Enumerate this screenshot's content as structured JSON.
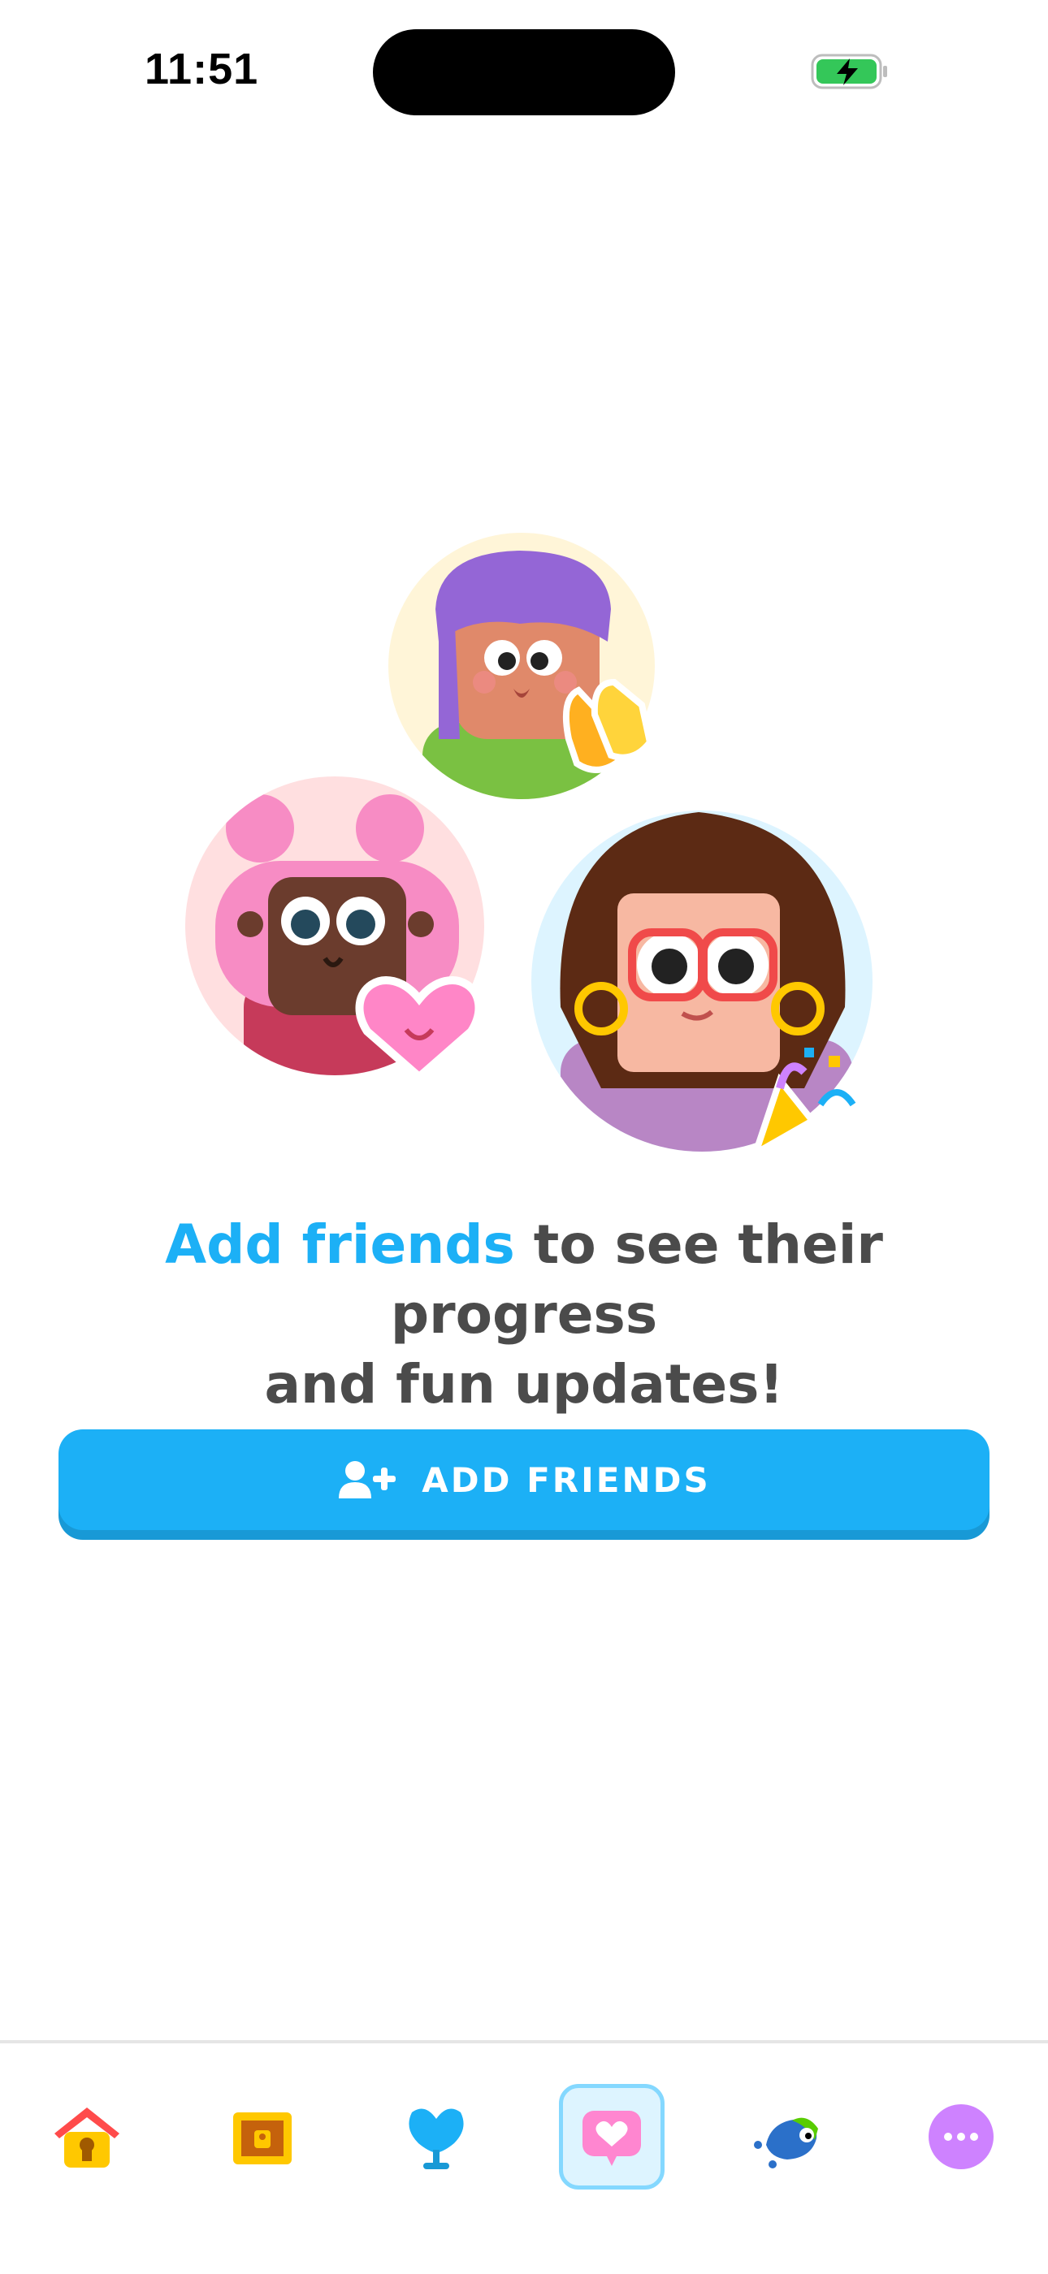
{
  "status_bar": {
    "time": "11:51"
  },
  "headline": {
    "accent": "Add friends",
    "rest_line1": " to see their progress",
    "rest_line2": "and fun updates!"
  },
  "add_friends_button": {
    "label": "ADD FRIENDS"
  },
  "colors": {
    "accent_blue": "#1cb0f6",
    "button_shadow": "#1899d6",
    "text_dark": "#4b4b4b",
    "nav_active_bg": "#ddf4ff",
    "nav_active_border": "#84d8ff"
  },
  "bottom_nav": {
    "items": [
      {
        "icon": "home-icon",
        "active": false
      },
      {
        "icon": "chest-icon",
        "active": false
      },
      {
        "icon": "league-icon",
        "active": false
      },
      {
        "icon": "friends-heart-icon",
        "active": true
      },
      {
        "icon": "bird-icon",
        "active": false
      },
      {
        "icon": "more-icon",
        "active": false
      }
    ]
  }
}
